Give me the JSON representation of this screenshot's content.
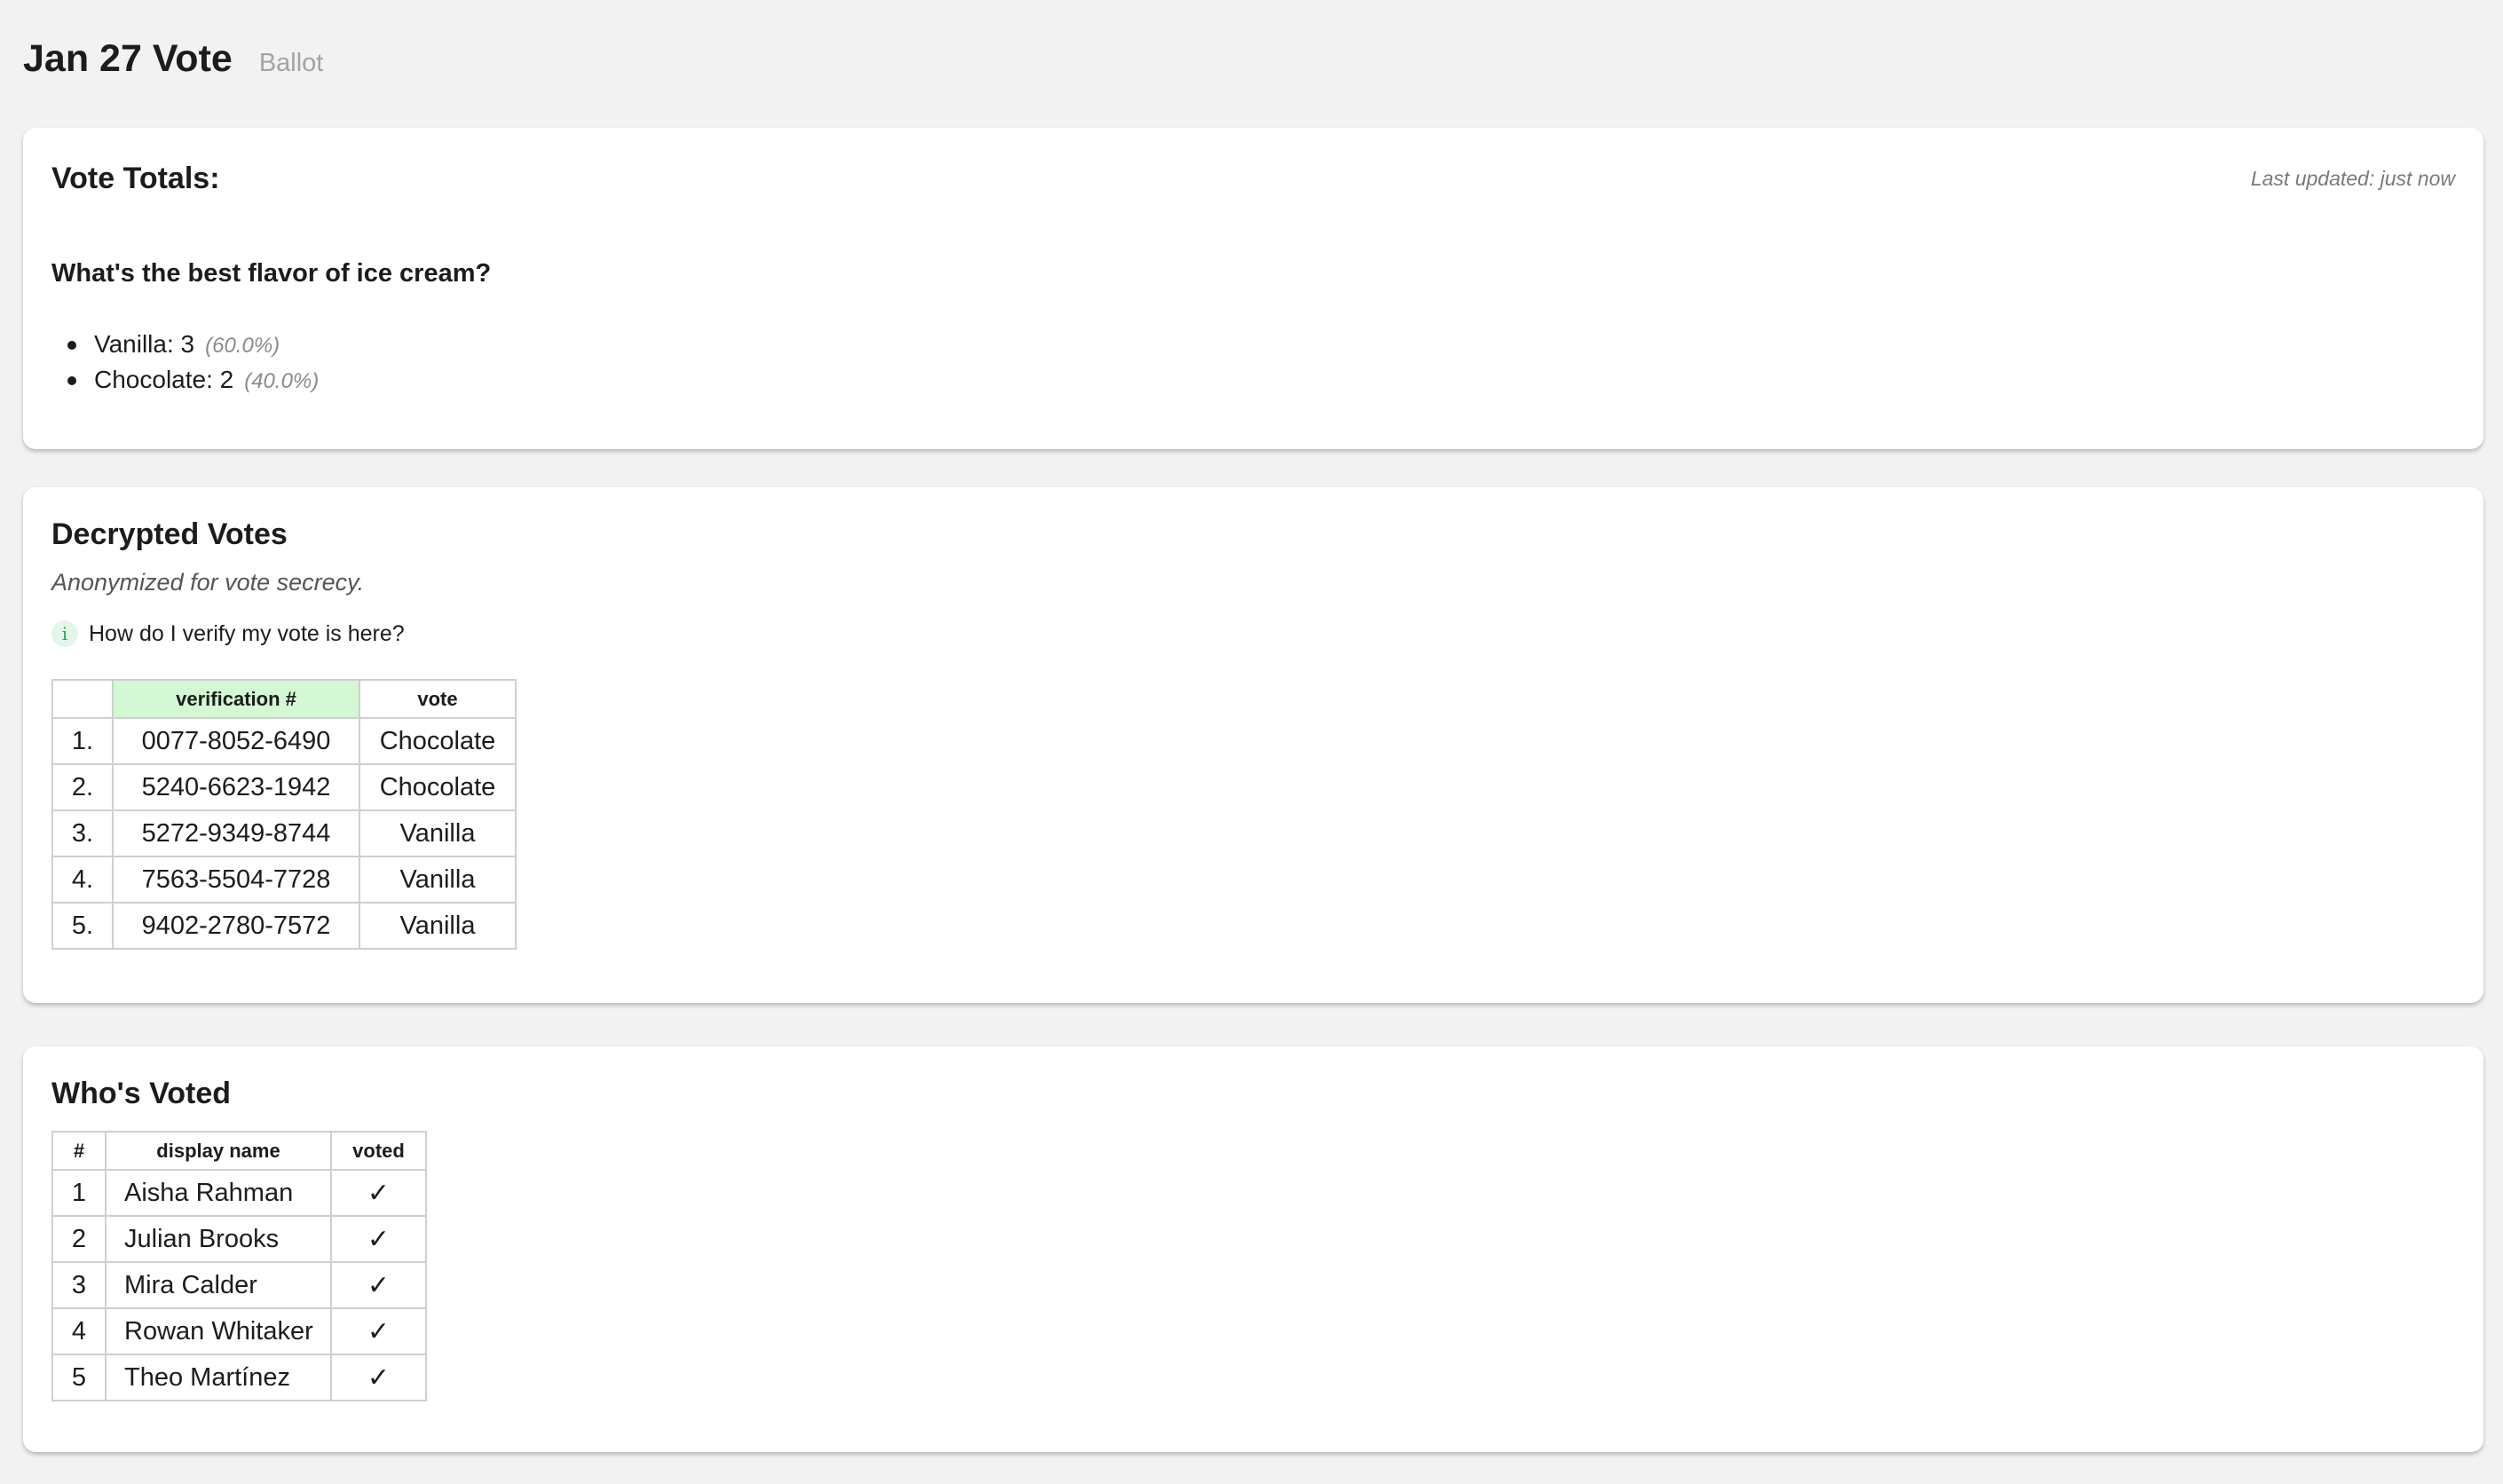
{
  "header": {
    "title": "Jan 27 Vote",
    "subtitle": "Ballot"
  },
  "totals": {
    "title": "Vote Totals:",
    "last_updated": "Last updated: just now",
    "question": "What's the best flavor of ice cream?",
    "options": [
      {
        "label": "Vanilla: 3",
        "pct": "(60.0%)"
      },
      {
        "label": "Chocolate: 2",
        "pct": "(40.0%)"
      }
    ]
  },
  "decrypted": {
    "title": "Decrypted Votes",
    "note": "Anonymized for vote secrecy.",
    "info_icon": "i",
    "verify_link": "How do I verify my vote is here?",
    "columns": [
      "",
      "verification #",
      "vote"
    ],
    "rows": [
      {
        "num": "1.",
        "code": "0077-8052-6490",
        "vote": "Chocolate"
      },
      {
        "num": "2.",
        "code": "5240-6623-1942",
        "vote": "Chocolate"
      },
      {
        "num": "3.",
        "code": "5272-9349-8744",
        "vote": "Vanilla"
      },
      {
        "num": "4.",
        "code": "7563-5504-7728",
        "vote": "Vanilla"
      },
      {
        "num": "5.",
        "code": "9402-2780-7572",
        "vote": "Vanilla"
      }
    ]
  },
  "voted": {
    "title": "Who's Voted",
    "columns": [
      "#",
      "display name",
      "voted"
    ],
    "check": "✓",
    "rows": [
      {
        "num": "1",
        "name": "Aisha Rahman"
      },
      {
        "num": "2",
        "name": "Julian Brooks"
      },
      {
        "num": "3",
        "name": "Mira Calder"
      },
      {
        "num": "4",
        "name": "Rowan Whitaker"
      },
      {
        "num": "5",
        "name": "Theo Martínez"
      }
    ]
  }
}
